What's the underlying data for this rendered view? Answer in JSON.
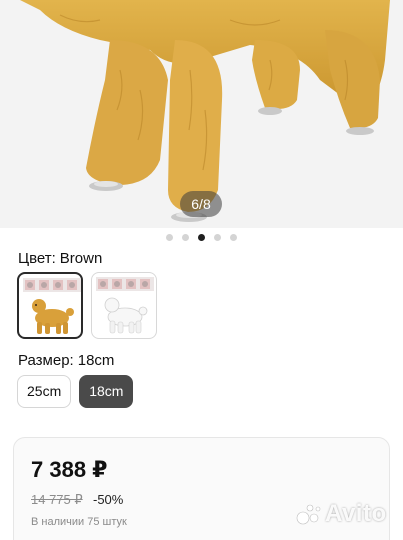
{
  "gallery": {
    "counter": "6/8",
    "dots_count": 5,
    "active_dot": 2
  },
  "color_selector": {
    "label": "Цвет:",
    "value": "Brown",
    "options": [
      {
        "name": "Brown",
        "selected": true
      },
      {
        "name": "White",
        "selected": false
      }
    ]
  },
  "size_selector": {
    "label": "Размер:",
    "value": "18cm",
    "options": [
      {
        "label": "25cm",
        "selected": false
      },
      {
        "label": "18cm",
        "selected": true
      }
    ]
  },
  "price": {
    "current": "7 388 ₽",
    "old": "14 775 ₽",
    "discount": "-50%",
    "stock": "В наличии 75 штук"
  },
  "watermark": {
    "text": "Avito"
  },
  "colors": {
    "fur": "#d9a83f",
    "selected_size_bg": "#4a4a4a",
    "active_dot": "#1f1f1f"
  }
}
